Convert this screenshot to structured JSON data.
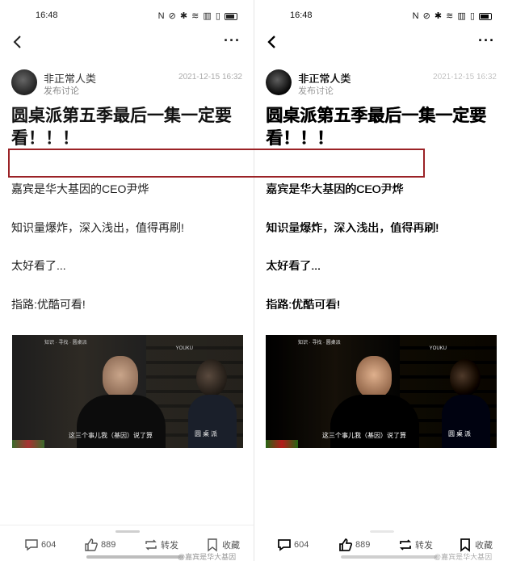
{
  "status_bar": {
    "time": "16:48",
    "icons_text": "N ⊘ ✱ ≋ ▥ ▯"
  },
  "author": {
    "name": "非正常人类",
    "subtitle": "发布讨论",
    "time": "2021-12-15 16:32"
  },
  "post": {
    "title": "圆桌派第五季最后一集一定要看！！！",
    "lines": [
      "嘉宾是华大基因的CEO尹烨",
      "知识量爆炸，深入浅出，值得再刷!",
      "太好看了...",
      "指路:优酷可看!"
    ]
  },
  "video": {
    "caption": "这三个事儿我（基因）说了算",
    "brand": "YOUKU",
    "show_logo": "圆桌派",
    "top_text": "知识 · 寻找 · 圆桌派"
  },
  "actions": {
    "comment_count": "604",
    "like_count": "889",
    "repost_label": "转发",
    "favorite_label": "收藏"
  },
  "watermark": "@嘉宾是华大基因",
  "icons": [
    "back-arrow-icon",
    "more-dots-icon",
    "comment-icon",
    "like-icon",
    "repost-icon",
    "favorite-icon"
  ],
  "colors": {
    "highlight": "#9b2226"
  }
}
